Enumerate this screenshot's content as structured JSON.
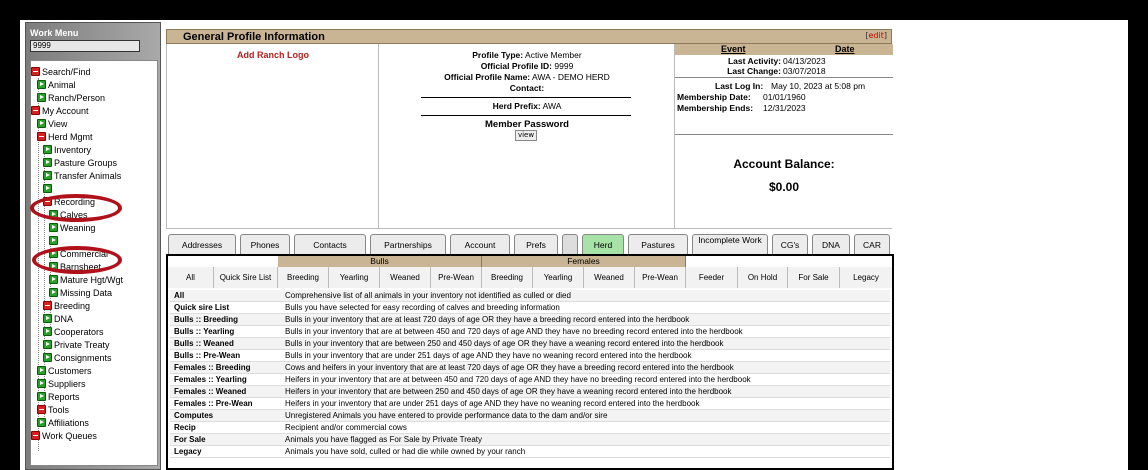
{
  "sidebar": {
    "title": "Work Menu",
    "input_value": "9999",
    "items": [
      {
        "label": "Search/Find",
        "icon": "collapse-icon"
      },
      {
        "label": "Animal",
        "icon": "expand-icon"
      },
      {
        "label": "Ranch/Person",
        "icon": "expand-icon"
      },
      {
        "label": "My Account",
        "icon": "collapse-icon"
      },
      {
        "label": "View",
        "icon": "expand-icon"
      },
      {
        "label": "Herd Mgmt",
        "icon": "collapse-icon"
      },
      {
        "label": "Inventory",
        "icon": "expand-icon"
      },
      {
        "label": "Pasture Groups",
        "icon": "expand-icon"
      },
      {
        "label": "Transfer Animals",
        "icon": "expand-icon"
      },
      {
        "label": "",
        "icon": "expand-icon"
      },
      {
        "label": "Recording",
        "icon": "collapse-icon"
      },
      {
        "label": "Calves",
        "icon": "expand-icon"
      },
      {
        "label": "Weaning",
        "icon": "expand-icon"
      },
      {
        "label": "",
        "icon": "expand-icon"
      },
      {
        "label": "Commercial",
        "icon": "expand-icon"
      },
      {
        "label": "Barnsheet",
        "icon": "expand-icon"
      },
      {
        "label": "Mature Hgt/Wgt",
        "icon": "expand-icon"
      },
      {
        "label": "Missing Data",
        "icon": "expand-icon"
      },
      {
        "label": "Breeding",
        "icon": "collapse-icon"
      },
      {
        "label": "DNA",
        "icon": "expand-icon"
      },
      {
        "label": "Cooperators",
        "icon": "expand-icon"
      },
      {
        "label": "Private Treaty",
        "icon": "expand-icon"
      },
      {
        "label": "Consignments",
        "icon": "expand-icon"
      },
      {
        "label": "Customers",
        "icon": "expand-icon"
      },
      {
        "label": "Suppliers",
        "icon": "expand-icon"
      },
      {
        "label": "Reports",
        "icon": "expand-icon"
      },
      {
        "label": "Tools",
        "icon": "collapse-icon"
      },
      {
        "label": "Affiliations",
        "icon": "expand-icon"
      },
      {
        "label": "Work Queues",
        "icon": "collapse-icon"
      }
    ]
  },
  "profile": {
    "title": "General Profile Information",
    "edit_label": "edit",
    "add_logo_label": "Add Ranch Logo",
    "profile_type_label": "Profile Type:",
    "profile_type_value": "Active Member",
    "profile_id_label": "Official Profile ID:",
    "profile_id_value": "9999",
    "profile_name_label": "Official Profile Name:",
    "profile_name_value": "AWA - DEMO HERD",
    "contact_label": "Contact:",
    "herd_prefix_label": "Herd Prefix:",
    "herd_prefix_value": "AWA",
    "member_password_label": "Member Password",
    "view_label": "view"
  },
  "events": {
    "event_header": "Event",
    "date_header": "Date",
    "last_activity_label": "Last Activity:",
    "last_activity_value": "04/13/2023",
    "last_change_label": "Last Change:",
    "last_change_value": "03/07/2018",
    "last_login_label": "Last Log In:",
    "last_login_value": "May 10, 2023 at 5:08 pm",
    "membership_date_label": "Membership Date:",
    "membership_date_value": "01/01/1960",
    "membership_ends_label": "Membership Ends:",
    "membership_ends_value": "12/31/2023",
    "balance_label": "Account Balance:",
    "balance_value": "$0.00"
  },
  "tabs": [
    "Addresses",
    "Phones",
    "Contacts",
    "Partnerships",
    "Account",
    "Prefs",
    "",
    "Herd",
    "Pastures",
    "Incomplete Work",
    "CG's",
    "DNA",
    "CAR"
  ],
  "active_tab": "Herd",
  "herd_groups": {
    "bulls": "Bulls",
    "females": "Females"
  },
  "herd_subtabs": [
    "All",
    "Quick Sire List",
    "Breeding",
    "Yearling",
    "Weaned",
    "Pre-Wean",
    "Breeding",
    "Yearling",
    "Weaned",
    "Pre-Wean",
    "Feeder",
    "On Hold",
    "For Sale",
    "Legacy"
  ],
  "descriptions": [
    {
      "key": "All",
      "text": "Comprehensive list of all animals in your inventory not identified as culled or died"
    },
    {
      "key": "Quick sire List",
      "text": "Bulls you have selected for easy recording of calves and breeding information"
    },
    {
      "key": "Bulls :: Breeding",
      "text": "Bulls in your inventory that are at least 720 days of age OR they have a breeding record entered into the herdbook"
    },
    {
      "key": "Bulls :: Yearling",
      "text": "Bulls in your inventory that are at between 450 and 720 days of age AND they have no breeding record entered into the herdbook"
    },
    {
      "key": "Bulls :: Weaned",
      "text": "Bulls in your inventory that are between 250 and 450 days of age OR they have a weaning record entered into the herdbook"
    },
    {
      "key": "Bulls :: Pre-Wean",
      "text": "Bulls in your inventory that are under 251 days of age AND they have no weaning record entered into the herdbook"
    },
    {
      "key": "Females :: Breeding",
      "text": "Cows and heifers in your inventory that are at least 720 days of age OR they have a breeding record entered into the herdbook"
    },
    {
      "key": "Females :: Yearling",
      "text": "Heifers in your inventory that are at between 450 and 720 days of age AND they have no breeding record entered into the herdbook"
    },
    {
      "key": "Females :: Weaned",
      "text": "Heifers in your inventory that are between 250 and 450 days of age OR they have a weaning record entered into the herdbook"
    },
    {
      "key": "Females :: Pre-Wean",
      "text": "Heifers in your inventory that are under 251 days of age AND they have no weaning record entered into the herdbook"
    },
    {
      "key": "Computes",
      "text": "Unregistered Animals you have entered to provide performance data to the dam and/or sire"
    },
    {
      "key": "Recip",
      "text": "Recipient and/or commercial cows"
    },
    {
      "key": "For Sale",
      "text": "Animals you have flagged as For Sale by Private Treaty"
    },
    {
      "key": "Legacy",
      "text": "Animals you have sold, culled or had die while owned by your ranch"
    }
  ],
  "colors": {
    "header_tan": "#c9b493",
    "active_tab": "#a7e3a7",
    "annotation_red": "#b0101a",
    "logo_text": "#b22222"
  }
}
